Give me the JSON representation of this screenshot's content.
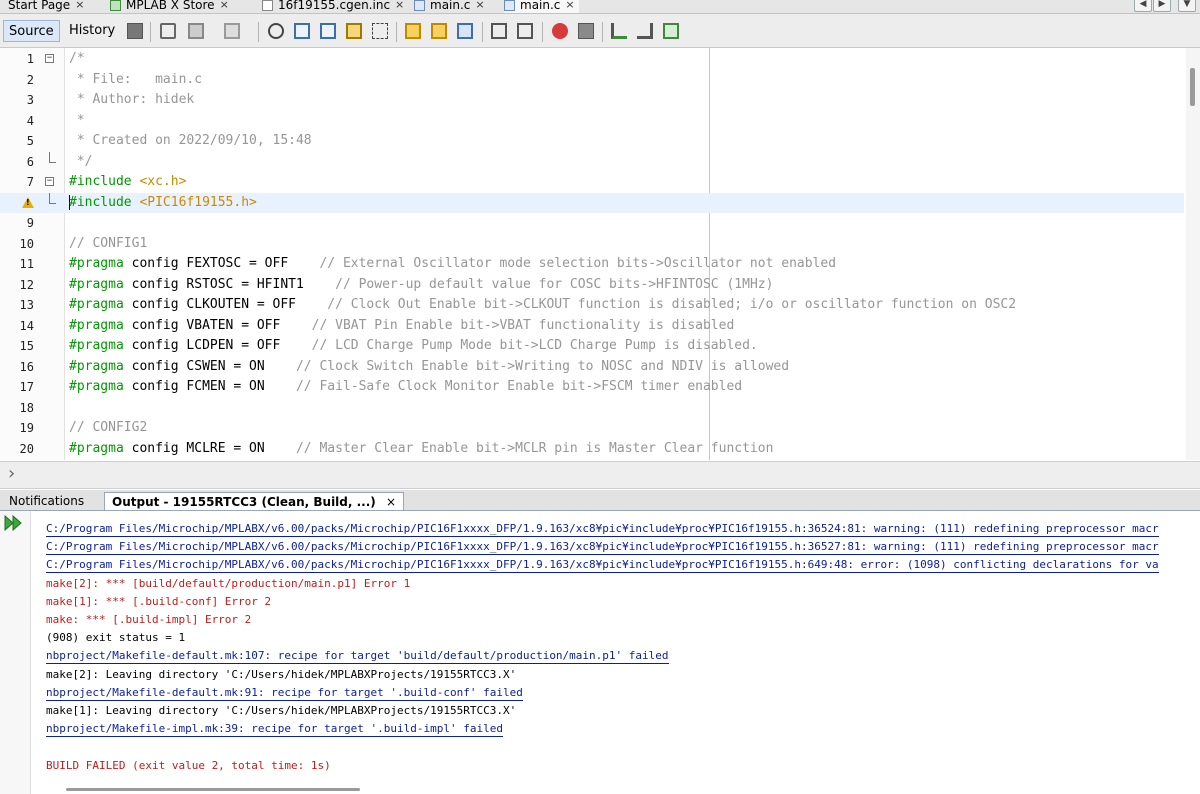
{
  "tabs": [
    {
      "label": "Start Page",
      "icon": "start-page-icon",
      "active": false
    },
    {
      "label": "MPLAB X Store",
      "icon": "store-cart-icon",
      "active": false
    },
    {
      "label": "16f19155.cgen.inc",
      "icon": "file-icon",
      "active": false
    },
    {
      "label": "main.c",
      "icon": "c-file-icon",
      "active": false
    },
    {
      "label": "main.c",
      "icon": "c-file-icon",
      "active": true
    }
  ],
  "tab_close_glyph": "×",
  "toolbar": {
    "source_label": "Source",
    "history_label": "History",
    "icons": [
      "last-edit-icon",
      "back-icon",
      "forward-icon",
      "find-icon",
      "find-previous-icon",
      "find-next-icon",
      "toggle-highlight-icon",
      "toggle-rectangular-selection-icon",
      "previous-bookmark-icon",
      "next-bookmark-icon",
      "toggle-bookmark-icon",
      "shift-left-icon",
      "shift-right-icon",
      "start-macro-recording-icon",
      "stop-macro-recording-icon",
      "comment-icon",
      "uncomment-icon",
      "format-icon"
    ]
  },
  "editor": {
    "lines": [
      {
        "num": "1",
        "text": "/*"
      },
      {
        "num": "2",
        "text": " * File:   main.c"
      },
      {
        "num": "3",
        "text": " * Author: hidek"
      },
      {
        "num": "4",
        "text": " *"
      },
      {
        "num": "5",
        "text": " * Created on 2022/09/10, 15:48"
      },
      {
        "num": "6",
        "text": " */"
      },
      {
        "num": "7",
        "text": "#include <xc.h>"
      },
      {
        "num": "",
        "text": "#include <PIC16f19155.h>"
      },
      {
        "num": "9",
        "text": ""
      },
      {
        "num": "10",
        "text": "// CONFIG1"
      },
      {
        "num": "11",
        "text": "#pragma config FEXTOSC = OFF    // External Oscillator mode selection bits->Oscillator not enabled"
      },
      {
        "num": "12",
        "text": "#pragma config RSTOSC = HFINT1    // Power-up default value for COSC bits->HFINTOSC (1MHz)"
      },
      {
        "num": "13",
        "text": "#pragma config CLKOUTEN = OFF    // Clock Out Enable bit->CLKOUT function is disabled; i/o or oscillator function on OSC2"
      },
      {
        "num": "14",
        "text": "#pragma config VBATEN = OFF    // VBAT Pin Enable bit->VBAT functionality is disabled"
      },
      {
        "num": "15",
        "text": "#pragma config LCDPEN = OFF    // LCD Charge Pump Mode bit->LCD Charge Pump is disabled."
      },
      {
        "num": "16",
        "text": "#pragma config CSWEN = ON    // Clock Switch Enable bit->Writing to NOSC and NDIV is allowed"
      },
      {
        "num": "17",
        "text": "#pragma config FCMEN = ON    // Fail-Safe Clock Monitor Enable bit->FSCM timer enabled"
      },
      {
        "num": "18",
        "text": ""
      },
      {
        "num": "19",
        "text": "// CONFIG2"
      },
      {
        "num": "20",
        "text": "#pragma config MCLRE = ON    // Master Clear Enable bit->MCLR pin is Master Clear function"
      }
    ]
  },
  "output_tabs": [
    {
      "label": "Notifications",
      "active": false
    },
    {
      "label": "Output - 19155RTCC3 (Clean, Build, ...)",
      "active": true
    }
  ],
  "output": {
    "lines": [
      {
        "text": "C:/Program Files/Microchip/MPLABX/v6.00/packs/Microchip/PIC16F1xxxx_DFP/1.9.163/xc8¥pic¥include¥proc¥PIC16f19155.h:36524:81: warning: (111) redefining preprocessor macr",
        "kind": "link"
      },
      {
        "text": "C:/Program Files/Microchip/MPLABX/v6.00/packs/Microchip/PIC16F1xxxx_DFP/1.9.163/xc8¥pic¥include¥proc¥PIC16f19155.h:36527:81: warning: (111) redefining preprocessor macr",
        "kind": "link"
      },
      {
        "text": "C:/Program Files/Microchip/MPLABX/v6.00/packs/Microchip/PIC16F1xxxx_DFP/1.9.163/xc8¥pic¥include¥proc¥PIC16f19155.h:649:48: error: (1098) conflicting declarations for va",
        "kind": "link"
      },
      {
        "text": "make[2]: *** [build/default/production/main.p1] Error 1",
        "kind": "err"
      },
      {
        "text": "make[1]: *** [.build-conf] Error 2",
        "kind": "err"
      },
      {
        "text": "make: *** [.build-impl] Error 2",
        "kind": "err"
      },
      {
        "text": "(908) exit status = 1",
        "kind": "plain"
      },
      {
        "text": "nbproject/Makefile-default.mk:107: recipe for target 'build/default/production/main.p1' failed",
        "kind": "link"
      },
      {
        "text": "make[2]: Leaving directory 'C:/Users/hidek/MPLABXProjects/19155RTCC3.X'",
        "kind": "plain"
      },
      {
        "text": "nbproject/Makefile-default.mk:91: recipe for target '.build-conf' failed",
        "kind": "link"
      },
      {
        "text": "make[1]: Leaving directory 'C:/Users/hidek/MPLABXProjects/19155RTCC3.X'",
        "kind": "plain"
      },
      {
        "text": "nbproject/Makefile-impl.mk:39: recipe for target '.build-impl' failed",
        "kind": "link"
      },
      {
        "text": "",
        "kind": "plain"
      },
      {
        "text": "BUILD FAILED (exit value 2, total time: 1s)",
        "kind": "err"
      }
    ]
  }
}
